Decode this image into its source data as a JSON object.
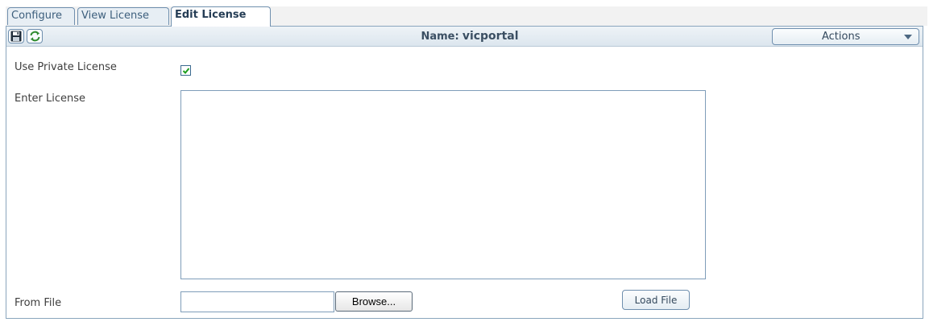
{
  "tabs": [
    {
      "label": "Configure",
      "active": false
    },
    {
      "label": "View License",
      "active": false
    },
    {
      "label": "Edit License",
      "active": true
    }
  ],
  "toolbar": {
    "save_icon": "floppy-disk-icon",
    "refresh_icon": "refresh-arrows-icon",
    "name_label": "Name:",
    "name_value": "vicportal",
    "actions_label": "Actions",
    "actions_icon": "chevron-down-icon"
  },
  "form": {
    "use_private_license": {
      "label": "Use Private License",
      "checked": true
    },
    "enter_license": {
      "label": "Enter License",
      "value": ""
    },
    "from_file": {
      "label": "From File",
      "value": "",
      "browse_label": "Browse...",
      "load_label": "Load File"
    }
  },
  "colors": {
    "tab_border": "#6f8fae",
    "panel_border": "#8aa5bd",
    "checkmark": "#1e9e1e",
    "text": "#3e3e3e"
  }
}
